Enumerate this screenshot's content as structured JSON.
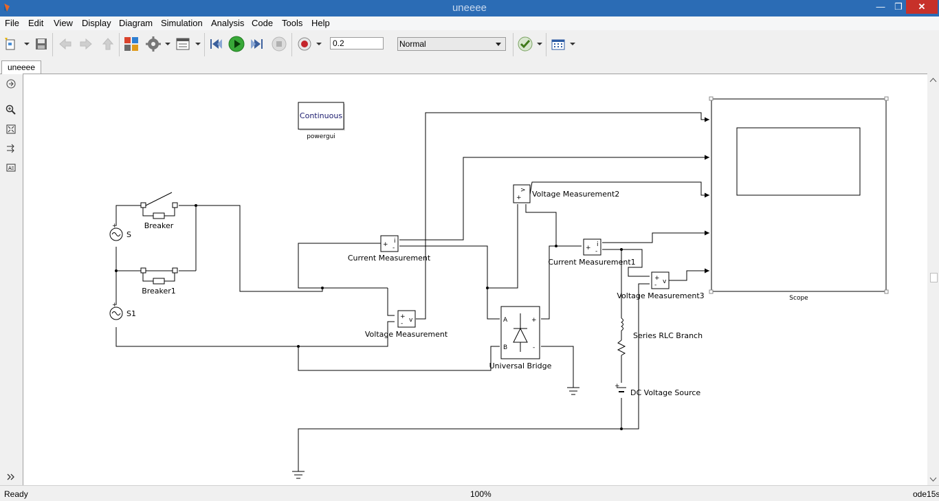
{
  "window": {
    "title": "uneeee"
  },
  "menu": [
    "File",
    "Edit",
    "View",
    "Display",
    "Diagram",
    "Simulation",
    "Analysis",
    "Code",
    "Tools",
    "Help"
  ],
  "toolbar": {
    "stop_time": "0.2",
    "sim_mode": "Normal"
  },
  "tabs": [
    {
      "label": "uneeee"
    }
  ],
  "blocks": {
    "powergui_text": "Continuous",
    "powergui": "powergui",
    "breaker": "Breaker",
    "breaker1": "Breaker1",
    "s": "S",
    "s1": "S1",
    "current_measurement": "Current Measurement",
    "voltage_measurement": "Voltage Measurement",
    "voltage_measurement2": "Voltage Measurement2",
    "current_measurement1": "Current Measurement1",
    "voltage_measurement3": "Voltage Measurement3",
    "universal_bridge": "Universal Bridge",
    "series_rlc": "Series RLC Branch",
    "dc_source": "DC Voltage Source",
    "scope": "Scope",
    "port_a": "A",
    "port_b": "B",
    "port_plus": "+",
    "port_minus": "-",
    "port_i": "i",
    "port_v": "v"
  },
  "status": {
    "ready": "Ready",
    "zoom": "100%",
    "solver": "ode15s"
  }
}
